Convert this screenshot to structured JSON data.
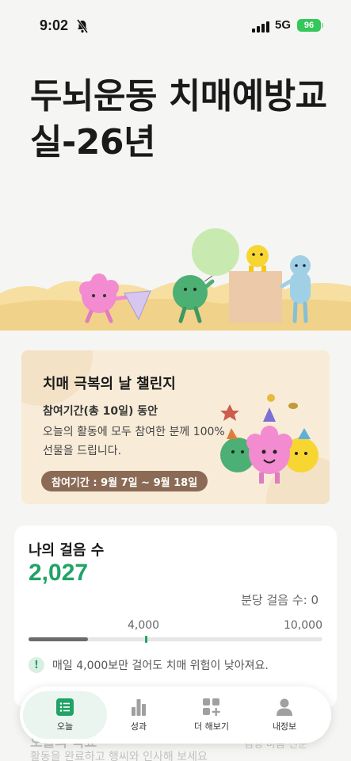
{
  "status": {
    "time": "9:02",
    "network": "5G",
    "battery": "96"
  },
  "title": "두뇌운동 치매예방교실-26년",
  "challenge": {
    "title": "치매 극복의 날 챌린지",
    "subtitle": "참여기간(총 10일) 동안",
    "description": "오늘의 활동에 모두 참여한 분께 100% 선물을 드립니다.",
    "period": "참여기간 : 9월 7일 ~ 9월 18일"
  },
  "steps": {
    "label": "나의 걸음 수",
    "value": "2,027",
    "per_minute": "분당 걸음 수: 0",
    "goal_mark": "4,000",
    "max_mark": "10,000",
    "progress": 0.2027,
    "goal_fraction": 0.4,
    "tip": "매일 4,000보만 걸어도 치매 위험이 낮아져요."
  },
  "below": {
    "heading": "오늘의 목표",
    "sub": "활동을 완료하고 행씨와 인사해 보세요"
  },
  "watermark": "김영 마음 신문",
  "tabs": [
    {
      "label": "오늘",
      "icon": "list-icon",
      "active": true
    },
    {
      "label": "성과",
      "icon": "bar-chart-icon",
      "active": false
    },
    {
      "label": "더 해보기",
      "icon": "add-grid-icon",
      "active": false
    },
    {
      "label": "내정보",
      "icon": "person-icon",
      "active": false
    }
  ],
  "colors": {
    "accent": "#21a366",
    "card": "#f8ecd8",
    "pill": "#8b6b55"
  }
}
